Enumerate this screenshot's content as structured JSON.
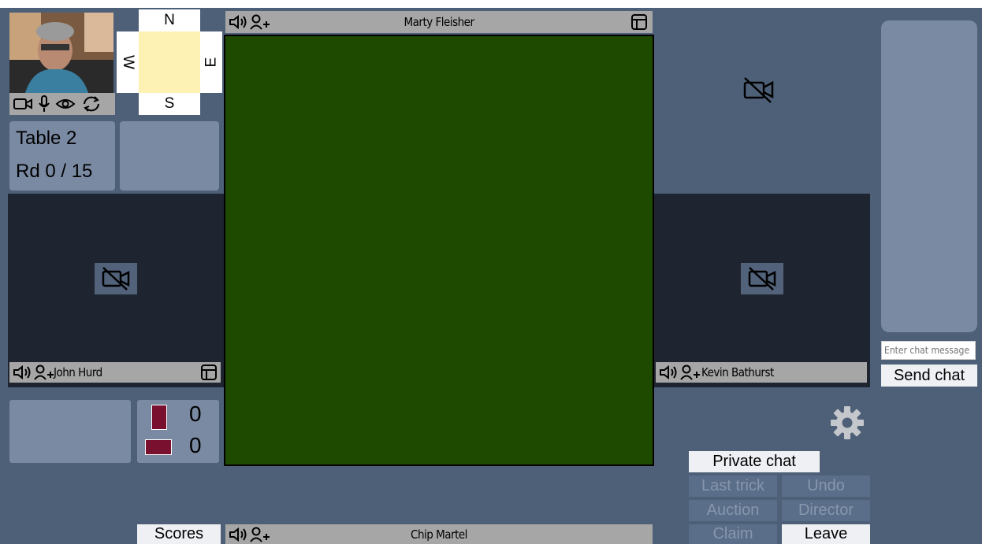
{
  "self_video": {
    "controls": [
      "video-icon",
      "mic-icon",
      "eye-icon",
      "refresh-icon"
    ]
  },
  "compass": {
    "north": "N",
    "south": "S",
    "east": "E",
    "west": "W"
  },
  "table_info": {
    "table": "Table 2",
    "round": "Rd 0 / 15"
  },
  "players": {
    "north": {
      "name": "Marty Fleisher"
    },
    "west": {
      "name": "John Hurd"
    },
    "east": {
      "name": "Kevin Bathurst"
    },
    "south": {
      "name": "Chip Martel"
    }
  },
  "tricks": {
    "vertical_count": "0",
    "horizontal_count": "0"
  },
  "colors": {
    "felt": "#1e4a00",
    "trick_card": "#7a1030",
    "background": "#4e6078"
  },
  "chat": {
    "placeholder": "Enter chat message",
    "send_label": "Send chat"
  },
  "buttons": {
    "scores": "Scores",
    "private_chat": "Private chat",
    "last_trick": "Last trick",
    "undo": "Undo",
    "auction": "Auction",
    "director": "Director",
    "claim": "Claim",
    "leave": "Leave"
  }
}
